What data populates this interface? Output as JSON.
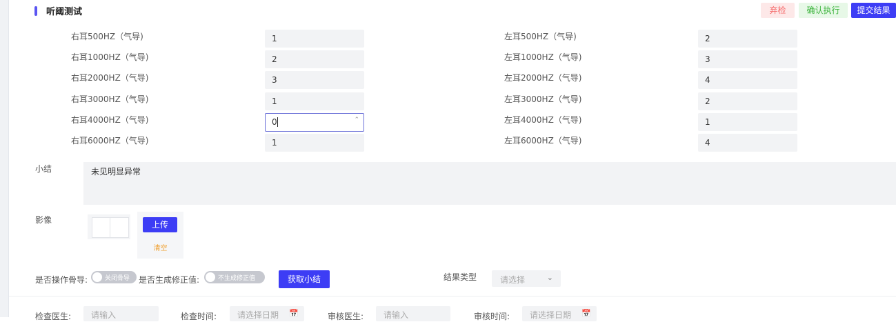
{
  "header": {
    "title": "听阈测试",
    "buttons": {
      "abandon": "弃检",
      "confirm": "确认执行",
      "submit": "提交结果"
    },
    "colors": {
      "accent": "#3d3df5",
      "abandon": "#f56c6c",
      "confirm": "#3bb33b"
    }
  },
  "thresholds": {
    "right": [
      {
        "label": "右耳500HZ（气导)",
        "value": "1"
      },
      {
        "label": "右耳1000HZ（气导)",
        "value": "2"
      },
      {
        "label": "右耳2000HZ（气导)",
        "value": "3"
      },
      {
        "label": "右耳3000HZ（气导)",
        "value": "1"
      },
      {
        "label": "右耳4000HZ（气导)",
        "value": "0"
      },
      {
        "label": "右耳6000HZ（气导)",
        "value": "1"
      }
    ],
    "left": [
      {
        "label": "左耳500HZ（气导)",
        "value": "2"
      },
      {
        "label": "左耳1000HZ（气导)",
        "value": "3"
      },
      {
        "label": "左耳2000HZ（气导)",
        "value": "4"
      },
      {
        "label": "左耳3000HZ（气导)",
        "value": "2"
      },
      {
        "label": "左耳4000HZ（气导)",
        "value": "1"
      },
      {
        "label": "左耳6000HZ（气导)",
        "value": "4"
      }
    ]
  },
  "summary": {
    "label": "小结",
    "value": "未见明显异常"
  },
  "image": {
    "label": "影像",
    "upload": "上传",
    "clear": "清空"
  },
  "options": {
    "bone_label": "是否操作骨导:",
    "bone_switch": "关闭骨导",
    "correction_label": "是否生成修正值:",
    "correction_switch": "不生成修正值",
    "get_summary": "获取小结",
    "result_type_label": "结果类型",
    "result_type_placeholder": "请选择"
  },
  "footer": {
    "doctor_label": "检查医生:",
    "doctor_placeholder": "请输入",
    "time_label": "检查时间:",
    "time_placeholder": "请选择日期",
    "reviewer_label": "审核医生:",
    "reviewer_placeholder": "请输入",
    "review_time_label": "审核时间:",
    "review_time_placeholder": "请选择日期"
  }
}
